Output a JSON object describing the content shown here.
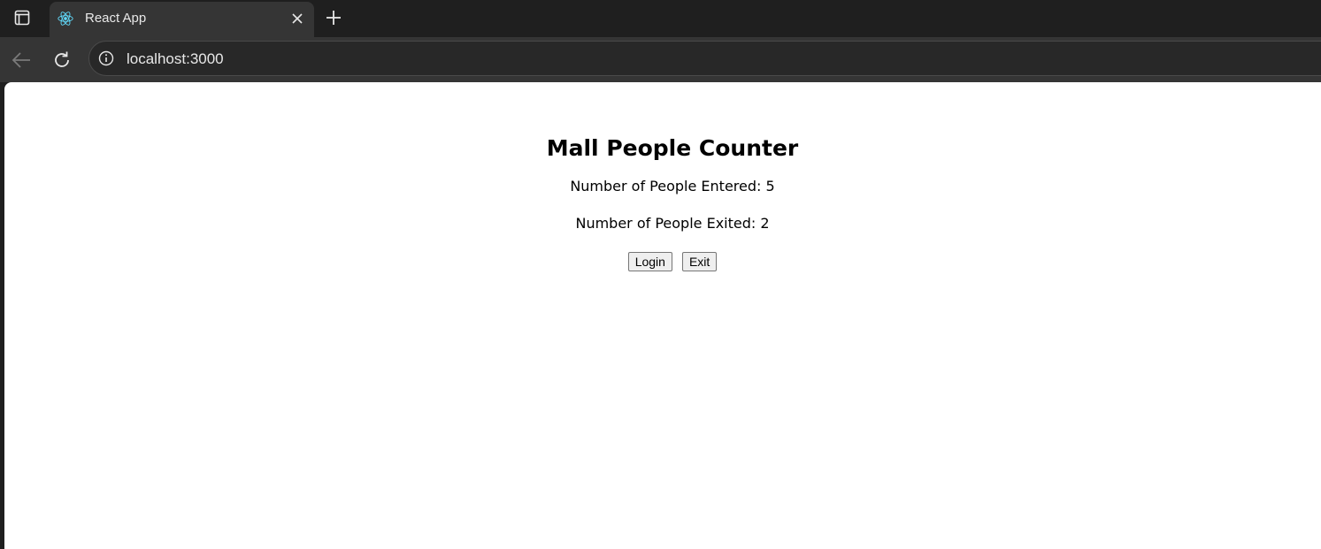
{
  "browser": {
    "tab": {
      "title": "React App",
      "favicon": "react-logo-icon"
    },
    "address_bar": {
      "url": "localhost:3000"
    },
    "colors": {
      "chrome_dark": "#1f1f1f",
      "chrome_toolbar": "#353535",
      "omnibox": "#282828",
      "react_logo": "#61dafb"
    }
  },
  "app": {
    "title": "Mall People Counter",
    "entered_label": "Number of People Entered: 5",
    "exited_label": "Number of People Exited: 2",
    "login_button": "Login",
    "exit_button": "Exit"
  }
}
